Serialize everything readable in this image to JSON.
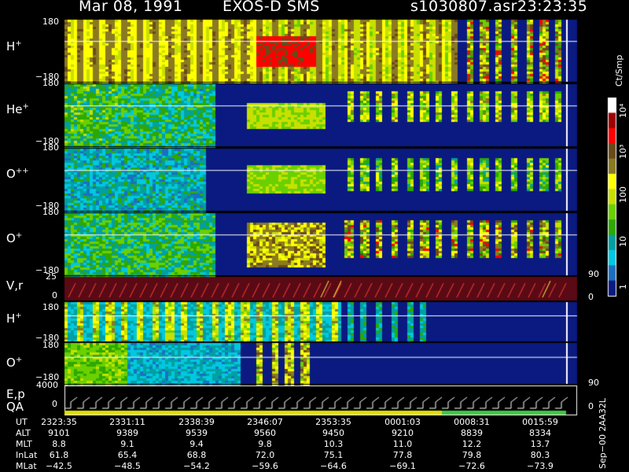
{
  "header": {
    "date": "Mar 08, 1991",
    "instrument": "EXOS-D SMS",
    "file": "s1030807.asr",
    "time": "23:23:35"
  },
  "panels": [
    {
      "id": "h_plus",
      "species": "H",
      "charge": "+",
      "top_tick": "180",
      "bottom_tick": "−180"
    },
    {
      "id": "he_plus",
      "species": "He",
      "charge": "+",
      "top_tick": "180",
      "bottom_tick": "−180"
    },
    {
      "id": "o_plus_plus",
      "species": "O",
      "charge": "++",
      "top_tick": "180",
      "bottom_tick": "−180"
    },
    {
      "id": "o_plus",
      "species": "O",
      "charge": "+",
      "top_tick": "180",
      "bottom_tick": "−180"
    },
    {
      "id": "vr",
      "label": "V,r",
      "top_tick": "25",
      "mid_tick": "0",
      "right_top": "90",
      "right_bottom": "0"
    },
    {
      "id": "h_plus_2",
      "species": "H",
      "charge": "+",
      "top_tick": "180",
      "bottom_tick": "−180"
    },
    {
      "id": "o_plus_2",
      "species": "O",
      "charge": "+",
      "top_tick": "180",
      "bottom_tick": "−180",
      "right_bottom": "90"
    },
    {
      "id": "ep_qa",
      "label1": "E,p",
      "label2": "QA",
      "top_tick": "4000",
      "mid_tick": "0",
      "right_bottom": "0"
    }
  ],
  "colorbar": {
    "unit": "Ct/Smp",
    "ticks": [
      "10⁴",
      "10³",
      "100",
      "10",
      "1"
    ],
    "colors": [
      "#ffffff",
      "#a00000",
      "#ff0000",
      "#6b4a1a",
      "#8a7a22",
      "#ffff00",
      "#c8e000",
      "#6ad000",
      "#2ea800",
      "#00a0a0",
      "#00c8e0",
      "#1a70c0",
      "#0a1a80"
    ]
  },
  "footer": {
    "labels": [
      "UT",
      "ALT",
      "MLT",
      "InLat",
      "MLat"
    ],
    "columns": [
      {
        "UT": "2323:35",
        "ALT": "9101",
        "MLT": "8.8",
        "InLat": "61.8",
        "MLat": "−42.5"
      },
      {
        "UT": "2331:11",
        "ALT": "9389",
        "MLT": "9.1",
        "InLat": "65.4",
        "MLat": "−48.5"
      },
      {
        "UT": "2338:39",
        "ALT": "9539",
        "MLT": "9.4",
        "InLat": "68.8",
        "MLat": "−54.2"
      },
      {
        "UT": "2346:07",
        "ALT": "9560",
        "MLT": "9.8",
        "InLat": "72.0",
        "MLat": "−59.6"
      },
      {
        "UT": "2353:35",
        "ALT": "9450",
        "MLT": "10.3",
        "InLat": "75.1",
        "MLat": "−64.6"
      },
      {
        "UT": "0001:03",
        "ALT": "9210",
        "MLT": "11.0",
        "InLat": "77.8",
        "MLat": "−69.1"
      },
      {
        "UT": "0008:31",
        "ALT": "8839",
        "MLT": "12.2",
        "InLat": "79.8",
        "MLat": "−72.6"
      },
      {
        "UT": "0015:59",
        "ALT": "8334",
        "MLT": "13.7",
        "InLat": "80.3",
        "MLat": "−73.9"
      }
    ],
    "side_note": "Sep−00  2AA32L"
  },
  "chart_data": {
    "type": "heatmap",
    "title": "Mar 08, 1991   EXOS-D SMS",
    "x_ticks": [
      "2323:35",
      "2331:11",
      "2338:39",
      "2346:07",
      "2353:35",
      "0001:03",
      "0008:31",
      "0015:59"
    ],
    "y_range": [
      -180,
      180
    ],
    "panels": [
      "H+",
      "He+",
      "O++",
      "O+",
      "V,r",
      "H+",
      "O+",
      "E,p QA"
    ],
    "color_scale": {
      "unit": "Ct/Smp",
      "scale": "log",
      "range": [
        1,
        10000
      ]
    }
  }
}
